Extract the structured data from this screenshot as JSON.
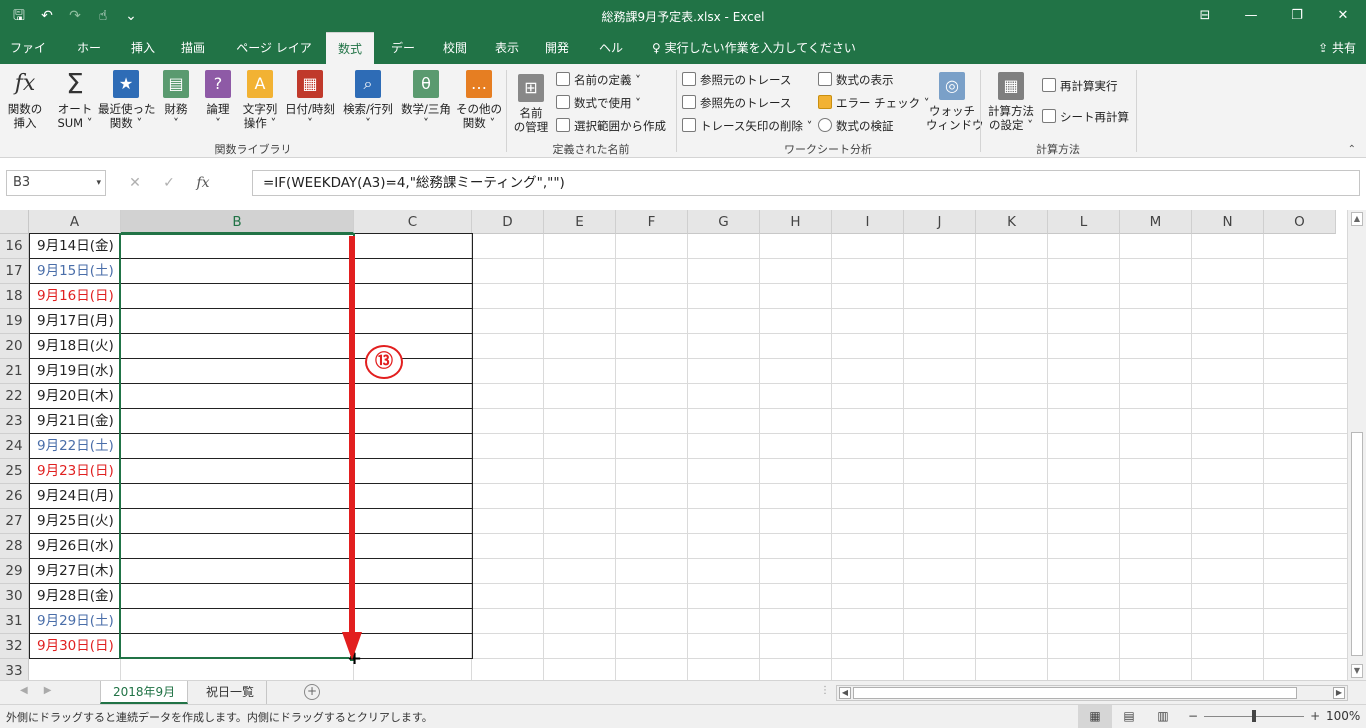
{
  "window": {
    "title": "総務課9月予定表.xlsx - Excel",
    "qat": {
      "save": "🖫",
      "undo": "↶",
      "redo": "↷",
      "touch": "☝",
      "more": "⌄"
    },
    "controls": {
      "ribbon_options": "⊟",
      "minimize": "—",
      "restore": "❐",
      "close": "✕"
    }
  },
  "tabs": [
    "ファイル",
    "ホーム",
    "挿入",
    "描画",
    "ページ レイアウト",
    "数式",
    "データ",
    "校閲",
    "表示",
    "開発",
    "ヘルプ"
  ],
  "active_tab": "数式",
  "tell_me": "♀ 実行したい作業を入力してください",
  "share": "⇪ 共有",
  "ribbon": {
    "insert_function": "関数の\n挿入",
    "autosum": "オート\nSUM ˅",
    "recent": "最近使った\n関数 ˅",
    "financial": "財務\n˅",
    "logical": "論理\n˅",
    "text": "文字列\n操作 ˅",
    "datetime": "日付/時刻\n˅",
    "lookup": "検索/行列\n˅",
    "math": "数学/三角\n˅",
    "more": "その他の\n関数 ˅",
    "group1": "関数ライブラリ",
    "name_manager": "名前\nの管理",
    "define_name": "名前の定義 ˅",
    "use_in_formula": "数式で使用 ˅",
    "create_from_sel": "選択範囲から作成",
    "group2": "定義された名前",
    "trace_prec": "参照元のトレース",
    "trace_dep": "参照先のトレース",
    "remove_arrows": "トレース矢印の削除 ˅",
    "show_formulas": "数式の表示",
    "error_check": "エラー チェック ˅",
    "evaluate": "数式の検証",
    "watch": "ウォッチ\nウィンドウ",
    "group3": "ワークシート分析",
    "calc_options": "計算方法\nの設定 ˅",
    "calc_now": "再計算実行",
    "calc_sheet": "シート再計算",
    "group4": "計算方法",
    "collapse": "⌃"
  },
  "formula_bar": {
    "name_box": "B3",
    "name_box_dd": "▾",
    "cancel": "✕",
    "enter": "✓",
    "fx": "fx",
    "formula": "=IF(WEEKDAY(A3)=4,\"総務課ミーティング\",\"\")"
  },
  "grid": {
    "columns": [
      "A",
      "B",
      "C",
      "D",
      "E",
      "F",
      "G",
      "H",
      "I",
      "J",
      "K",
      "L",
      "M",
      "N",
      "O"
    ],
    "selected_column": "B",
    "rows": [
      {
        "num": "16",
        "a": "9月14日(金)",
        "color": "blk"
      },
      {
        "num": "17",
        "a": "9月15日(土)",
        "color": "blu"
      },
      {
        "num": "18",
        "a": "9月16日(日)",
        "color": "red"
      },
      {
        "num": "19",
        "a": "9月17日(月)",
        "color": "blk"
      },
      {
        "num": "20",
        "a": "9月18日(火)",
        "color": "blk"
      },
      {
        "num": "21",
        "a": "9月19日(水)",
        "color": "blk"
      },
      {
        "num": "22",
        "a": "9月20日(木)",
        "color": "blk"
      },
      {
        "num": "23",
        "a": "9月21日(金)",
        "color": "blk"
      },
      {
        "num": "24",
        "a": "9月22日(土)",
        "color": "blu"
      },
      {
        "num": "25",
        "a": "9月23日(日)",
        "color": "red"
      },
      {
        "num": "26",
        "a": "9月24日(月)",
        "color": "blk"
      },
      {
        "num": "27",
        "a": "9月25日(火)",
        "color": "blk"
      },
      {
        "num": "28",
        "a": "9月26日(水)",
        "color": "blk"
      },
      {
        "num": "29",
        "a": "9月27日(木)",
        "color": "blk"
      },
      {
        "num": "30",
        "a": "9月28日(金)",
        "color": "blk"
      },
      {
        "num": "31",
        "a": "9月29日(土)",
        "color": "blu"
      },
      {
        "num": "32",
        "a": "9月30日(日)",
        "color": "red"
      },
      {
        "num": "33",
        "a": "",
        "color": "blk"
      }
    ],
    "cursor": "+"
  },
  "annotation": {
    "step_label": "⑬",
    "arrow_color": "#e21f1f"
  },
  "sheets": {
    "tabs": [
      "2018年9月",
      "祝日一覧"
    ],
    "active": "2018年9月",
    "add": "+",
    "nav_prev": "◀",
    "nav_next": "▶",
    "dots": "⋮"
  },
  "status": {
    "message": "外側にドラッグすると連続データを作成します。内側にドラッグするとクリアします。",
    "view_normal": "▦",
    "view_layout": "▤",
    "view_break": "▥",
    "zoom_minus": "−",
    "zoom_plus": "+",
    "zoom": "100%"
  },
  "colors": {
    "accent": "#217346",
    "saturday": "#4a6ea9",
    "sunday": "#e02020"
  }
}
